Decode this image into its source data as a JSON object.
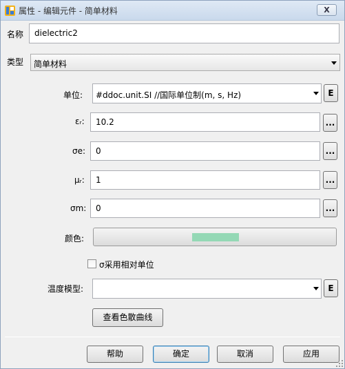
{
  "window": {
    "title": "属性 - 编辑元件 - 简单材料",
    "close_label": "X"
  },
  "form": {
    "name_label": "名称",
    "name_value": "dielectric2",
    "type_label": "类型",
    "type_value": "简单材料",
    "unit_label": "单位:",
    "unit_value": "#ddoc.unit.SI //国际单位制(m, s, Hz)",
    "unit_button": "E",
    "eps_label": "εᵣ:",
    "eps_value": "10.2",
    "sigma_e_label": "σe:",
    "sigma_e_value": "0",
    "mu_label": "μᵣ:",
    "mu_value": "1",
    "sigma_m_label": "σm:",
    "sigma_m_value": "0",
    "ellipsis": "...",
    "color_label": "颜色:",
    "color_value": "#94d8b5",
    "relative_unit_checkbox": "σ采用相对单位",
    "relative_unit_checked": false,
    "temp_model_label": "温度模型:",
    "temp_model_value": "",
    "temp_model_button": "E",
    "dispersion_button": "查看色散曲线"
  },
  "footer": {
    "help": "帮助",
    "ok": "确定",
    "cancel": "取消",
    "apply": "应用"
  }
}
